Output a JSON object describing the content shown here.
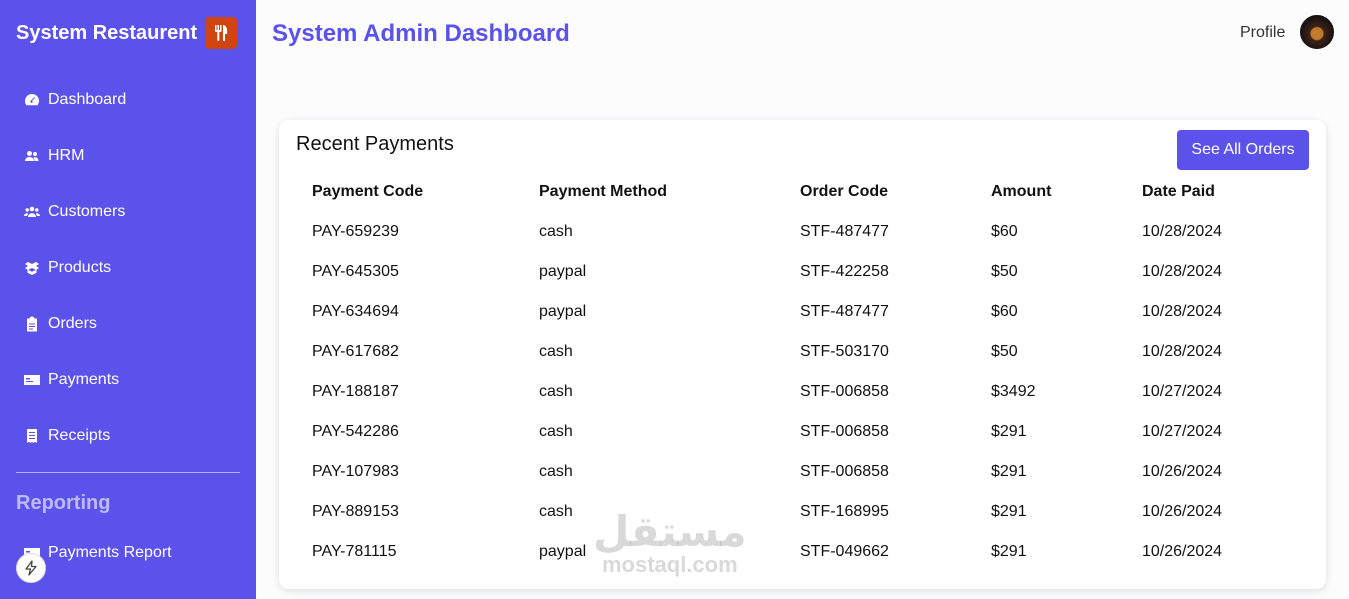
{
  "sidebar": {
    "brand_title": "System Restaurent",
    "brand_icon": "utensils-icon",
    "brand_icon_color": "#d1430f",
    "items": [
      {
        "label": "Dashboard",
        "icon": "gauge-icon"
      },
      {
        "label": "HRM",
        "icon": "users-icon"
      },
      {
        "label": "Customers",
        "icon": "group-icon"
      },
      {
        "label": "Products",
        "icon": "box-icon"
      },
      {
        "label": "Orders",
        "icon": "clipboard-icon"
      },
      {
        "label": "Payments",
        "icon": "card-icon"
      },
      {
        "label": "Receipts",
        "icon": "receipt-icon"
      }
    ],
    "section_title": "Reporting",
    "report_items": [
      {
        "label": "Payments Report",
        "icon": "report-icon"
      }
    ],
    "accent_color": "#5b52ec"
  },
  "header": {
    "title": "System Admin Dashboard",
    "profile_label": "Profile"
  },
  "recent_payments": {
    "title": "Recent Payments",
    "see_all_label": "See All Orders",
    "columns": [
      "Payment Code",
      "Payment Method",
      "Order Code",
      "Amount",
      "Date Paid"
    ],
    "rows": [
      [
        "PAY-659239",
        "cash",
        "STF-487477",
        "$60",
        "10/28/2024"
      ],
      [
        "PAY-645305",
        "paypal",
        "STF-422258",
        "$50",
        "10/28/2024"
      ],
      [
        "PAY-634694",
        "paypal",
        "STF-487477",
        "$60",
        "10/28/2024"
      ],
      [
        "PAY-617682",
        "cash",
        "STF-503170",
        "$50",
        "10/28/2024"
      ],
      [
        "PAY-188187",
        "cash",
        "STF-006858",
        "$3492",
        "10/27/2024"
      ],
      [
        "PAY-542286",
        "cash",
        "STF-006858",
        "$291",
        "10/27/2024"
      ],
      [
        "PAY-107983",
        "cash",
        "STF-006858",
        "$291",
        "10/26/2024"
      ],
      [
        "PAY-889153",
        "cash",
        "STF-168995",
        "$291",
        "10/26/2024"
      ],
      [
        "PAY-781115",
        "paypal",
        "STF-049662",
        "$291",
        "10/26/2024"
      ]
    ]
  },
  "watermark": {
    "arabic": "مستقل",
    "latin": "mostaql.com"
  }
}
